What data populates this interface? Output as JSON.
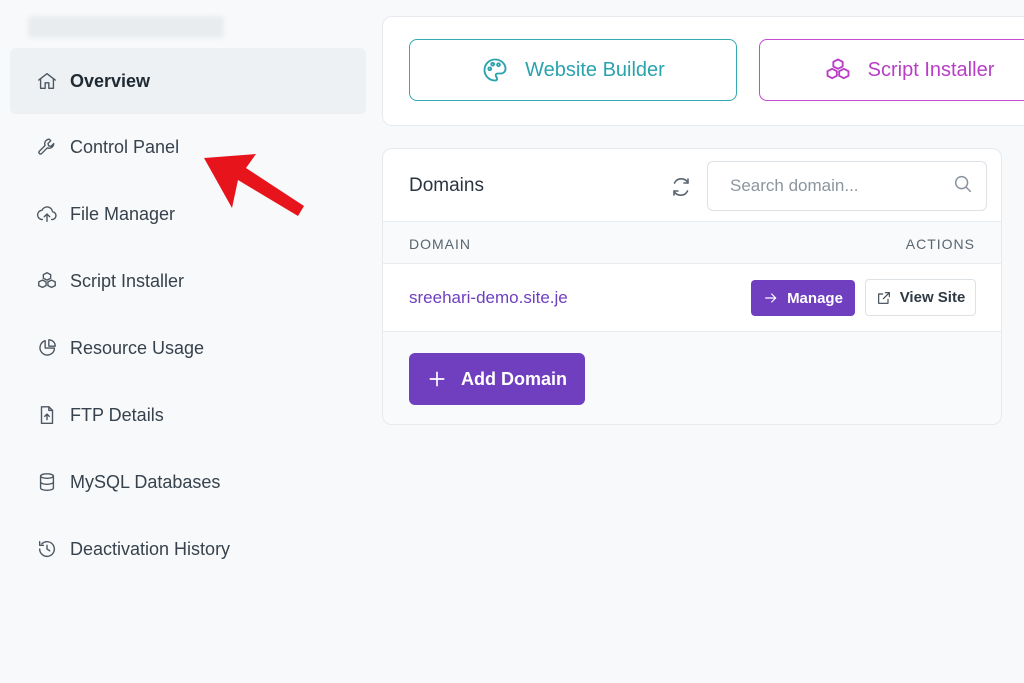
{
  "sidebar": {
    "items": [
      {
        "label": "Overview",
        "icon": "home-icon",
        "active": true
      },
      {
        "label": "Control Panel",
        "icon": "wrench-icon"
      },
      {
        "label": "File Manager",
        "icon": "cloud-upload-icon"
      },
      {
        "label": "Script Installer",
        "icon": "cubes-icon"
      },
      {
        "label": "Resource Usage",
        "icon": "pie-chart-icon"
      },
      {
        "label": "FTP Details",
        "icon": "file-upload-icon"
      },
      {
        "label": "MySQL Databases",
        "icon": "database-icon"
      },
      {
        "label": "Deactivation History",
        "icon": "history-icon"
      }
    ]
  },
  "tools": {
    "website_builder": {
      "label": "Website Builder",
      "icon": "palette-icon",
      "color": "#2aa3ae"
    },
    "script_installer": {
      "label": "Script Installer",
      "icon": "cubes-icon",
      "color": "#b93dc6"
    }
  },
  "domains": {
    "title": "Domains",
    "search_placeholder": "Search domain...",
    "columns": {
      "domain": "DOMAIN",
      "actions": "ACTIONS"
    },
    "rows": [
      {
        "domain": "sreehari-demo.site.je",
        "manage_label": "Manage",
        "view_label": "View Site"
      }
    ],
    "add_label": "Add Domain",
    "accent_color": "#6f3fc0"
  },
  "annotation": {
    "arrow_color": "#e8141b",
    "points_to": "Control Panel"
  }
}
